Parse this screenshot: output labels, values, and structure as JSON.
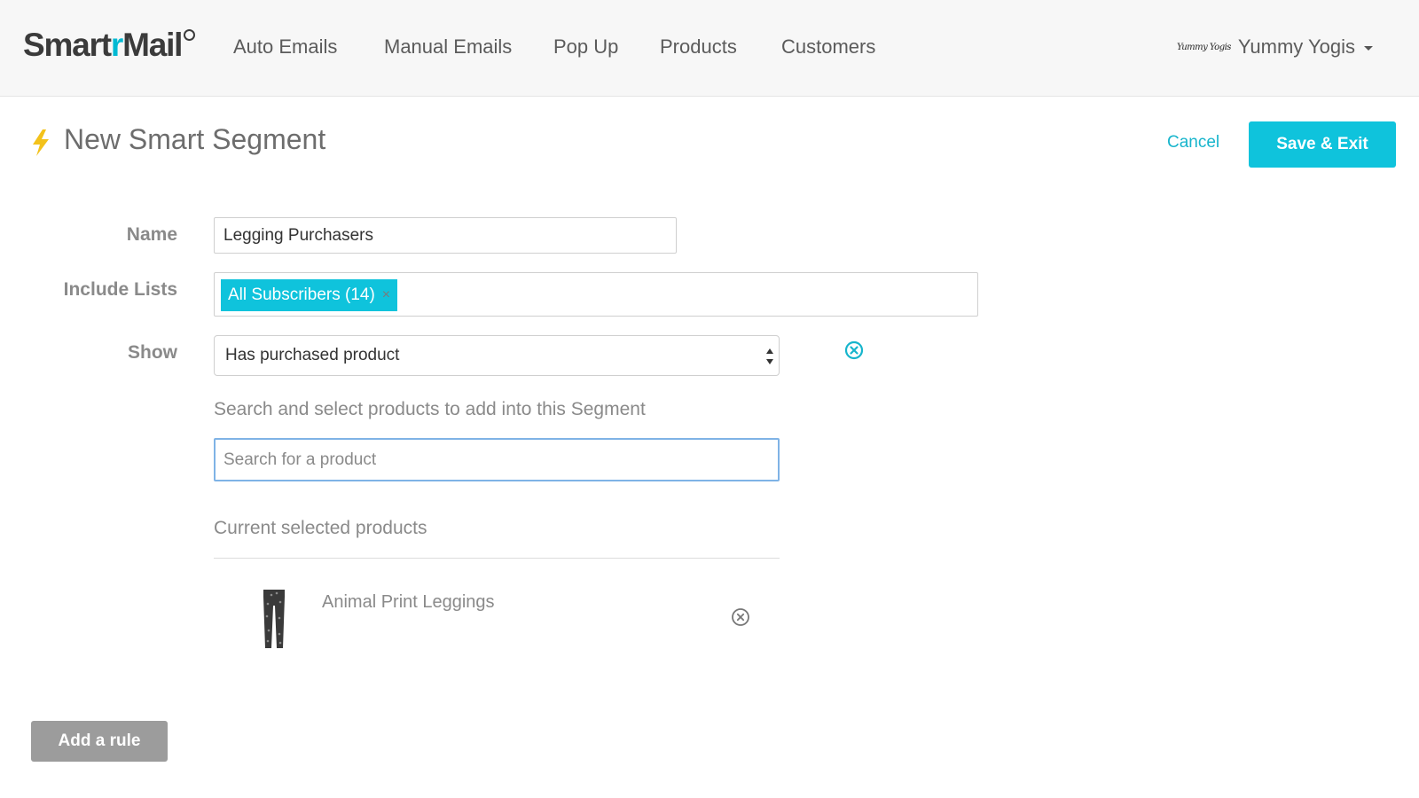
{
  "app": {
    "logo_text_a": "Smart",
    "logo_text_b": "r",
    "logo_text_c": "Mail",
    "accent_color": "#0fc3dc"
  },
  "nav": {
    "items": [
      {
        "label": "Auto Emails"
      },
      {
        "label": "Manual Emails"
      },
      {
        "label": "Pop Up"
      },
      {
        "label": "Products"
      },
      {
        "label": "Customers"
      }
    ]
  },
  "account": {
    "logo_text": "Yummy Yogis",
    "name": "Yummy Yogis"
  },
  "page": {
    "title": "New Smart Segment",
    "title_icon": "lightning-bolt-icon",
    "cancel_label": "Cancel",
    "save_label": "Save & Exit"
  },
  "form": {
    "name_label": "Name",
    "name_value": "Legging Purchasers",
    "include_lists_label": "Include Lists",
    "include_lists_tags": [
      {
        "label": "All Subscribers (14)",
        "remove_glyph": "×"
      }
    ],
    "show_label": "Show",
    "show_value": "Has purchased product",
    "remove_rule_icon": "circle-x-icon",
    "helper_text": "Search and select products to add into this Segment",
    "search_placeholder": "Search for a product",
    "selected_title": "Current selected products",
    "selected_products": [
      {
        "name": "Animal Print Leggings",
        "thumb_icon": "leggings-thumbnail"
      }
    ]
  },
  "footer": {
    "add_rule_label": "Add a rule"
  }
}
